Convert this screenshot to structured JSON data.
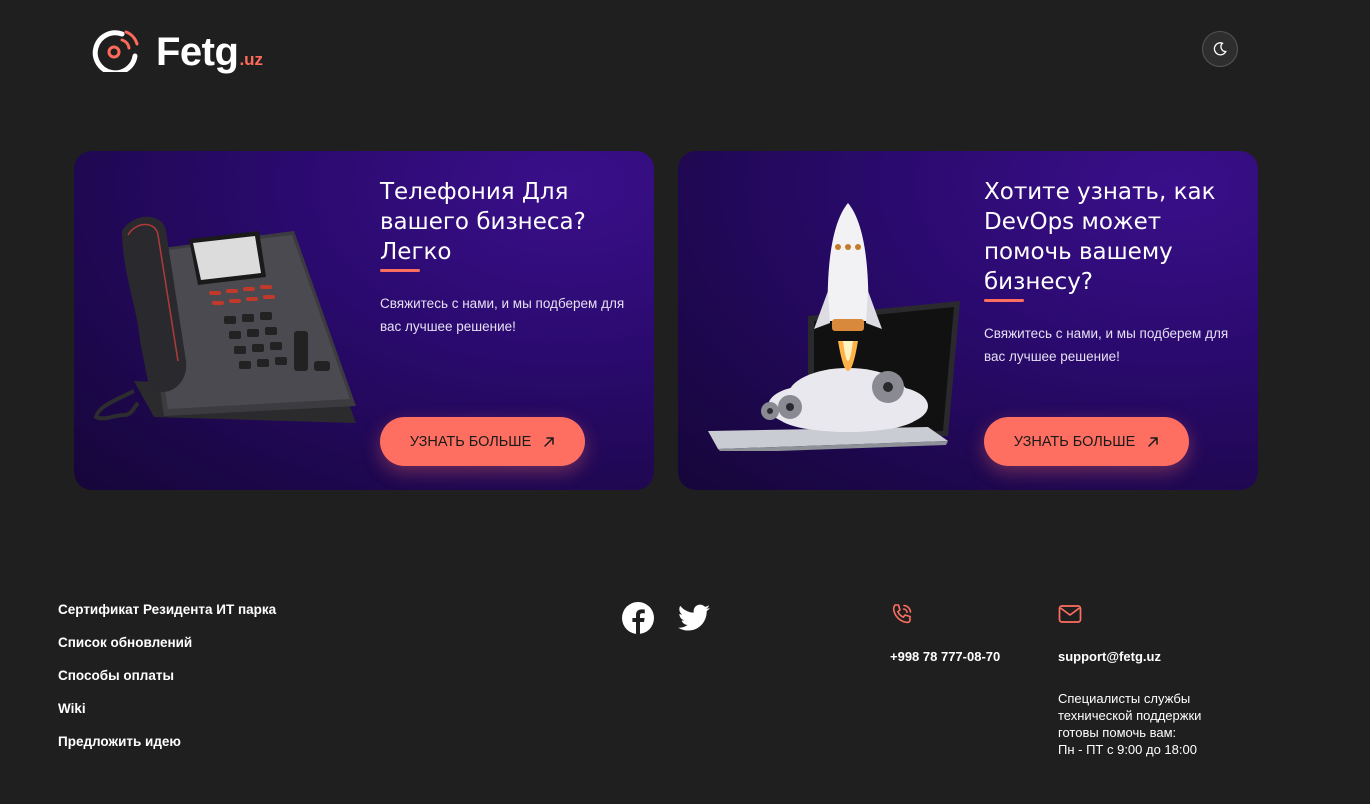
{
  "header": {
    "logo_text": "Fetg",
    "logo_tld": ".uz",
    "theme_toggle_icon": "moon-icon"
  },
  "cards": [
    {
      "title": "Телефония Для вашего бизнеса? Легко",
      "text": "Свяжитесь с нами, и мы подберем для вас лучшее решение!",
      "button_label": "УЗНАТЬ БОЛЬШЕ",
      "illustration": "desk-phone-illustration"
    },
    {
      "title": "Хотите узнать, как DevOps может помочь вашему бизнесу?",
      "text": "Свяжитесь с нами, и мы подберем для вас лучшее решение!",
      "button_label": "УЗНАТЬ БОЛЬШЕ",
      "illustration": "rocket-laptop-illustration"
    }
  ],
  "footer": {
    "links": [
      "Сертификат Резидента ИТ парка",
      "Список обновлений",
      "Способы оплаты",
      "Wiki",
      "Предложить идею"
    ],
    "social": [
      "facebook-icon",
      "twitter-icon"
    ],
    "phone": "+998 78 777-08-70",
    "email": "support@fetg.uz",
    "support_lines": [
      "Специалисты службы",
      "технической поддержки",
      "готовы помочь вам:",
      "Пн - ПТ с 9:00 до 18:00"
    ]
  },
  "colors": {
    "background": "#1f1f1f",
    "accent": "#ff6f61",
    "card_purple": "#2a0a6e"
  }
}
